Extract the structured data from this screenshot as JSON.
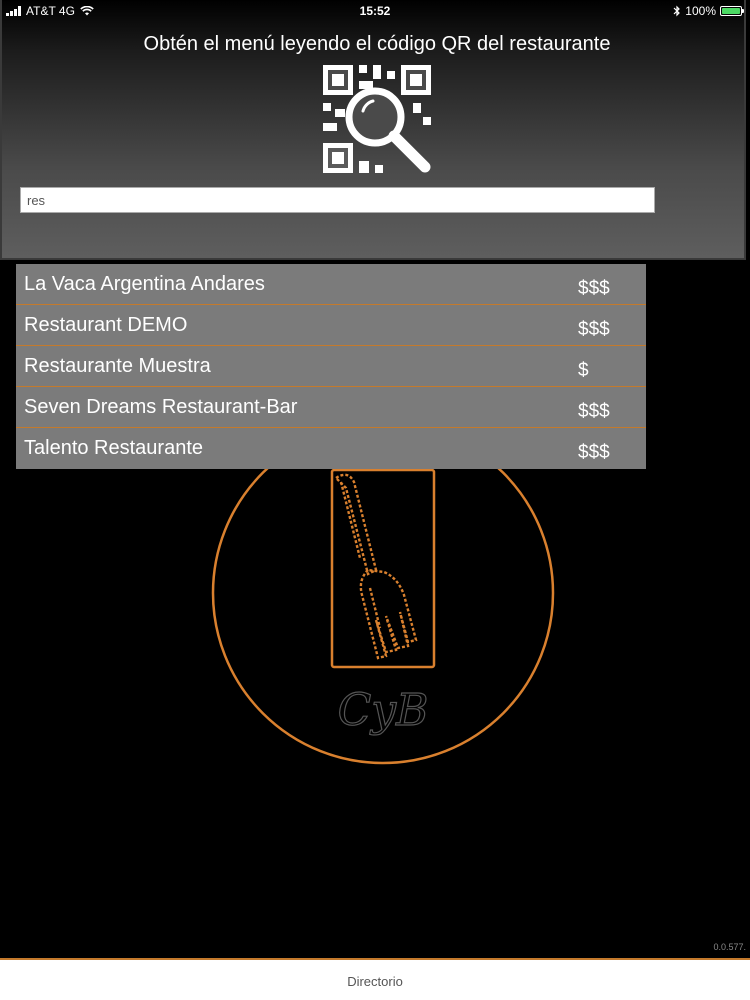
{
  "status_bar": {
    "carrier": "AT&T 4G",
    "time": "15:52",
    "battery": "100%",
    "battery_level": 1.0
  },
  "header": {
    "title": "Obtén el menú leyendo el código QR del restaurante",
    "qr_icon": "qr-search-icon"
  },
  "search": {
    "value": "res",
    "placeholder": ""
  },
  "results": [
    {
      "name": "La Vaca Argentina Andares",
      "price": "$$$"
    },
    {
      "name": "Restaurant DEMO",
      "price": "$$$"
    },
    {
      "name": "Restaurante Muestra",
      "price": "$"
    },
    {
      "name": "Seven Dreams Restaurant-Bar",
      "price": "$$$"
    },
    {
      "name": "Talento Restaurante",
      "price": "$$$"
    }
  ],
  "logo": {
    "text": "CyB",
    "icon": "fork-icon"
  },
  "version": "0.0.577.",
  "tab_bar": {
    "label": "Directorio"
  },
  "colors": {
    "accent": "#c47a2c",
    "row_bg": "#7b7b7b",
    "background": "#000000"
  }
}
